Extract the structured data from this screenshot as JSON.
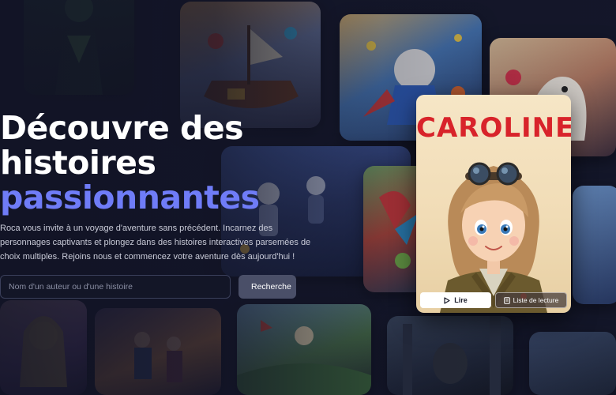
{
  "hero": {
    "headline_line1": "Découvre des",
    "headline_line2": "histoires",
    "headline_accent": "passionnantes",
    "description": "Roca vous invite à un voyage d'aventure sans précédent. Incarnez des personnages captivants et plongez dans des histoires interactives parsemées de choix multiples. Rejoins nous et commencez votre aventure dès aujourd'hui !"
  },
  "search": {
    "placeholder": "Nom d'un auteur ou d'une histoire",
    "button_label": "Recherche",
    "icon": "search-icon"
  },
  "featured_card": {
    "title": "CAROLINE",
    "read_label": "Lire",
    "read_icon": "play-icon",
    "list_label": "Liste de lecture",
    "list_icon": "bookmark-icon"
  },
  "colors": {
    "accent": "#6f7cf7",
    "background": "#14172a",
    "card_title": "#d8232a"
  }
}
